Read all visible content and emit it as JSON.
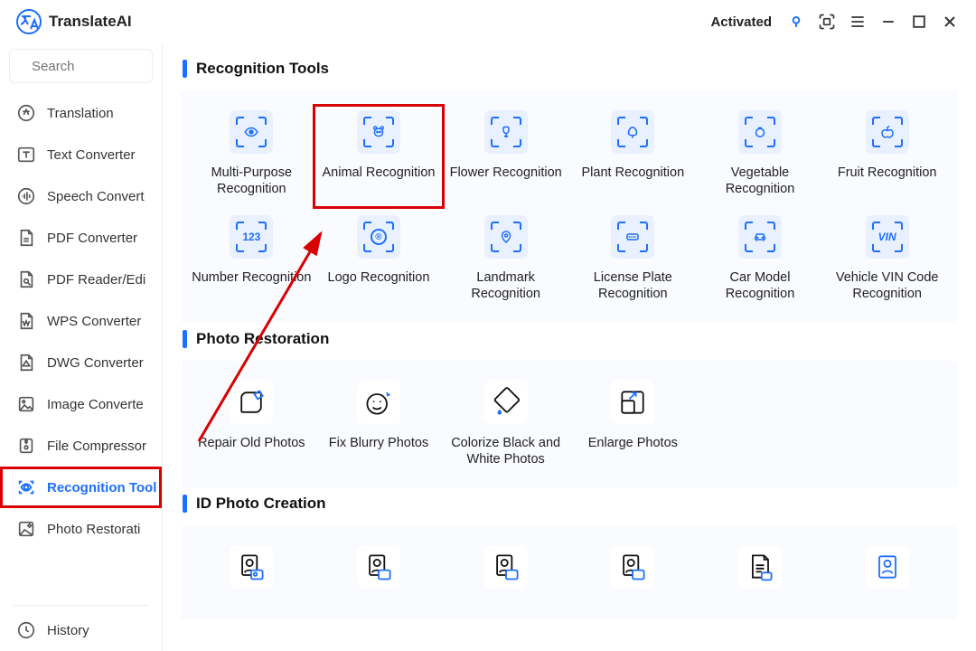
{
  "app": {
    "name": "TranslateAI",
    "status": "Activated"
  },
  "search": {
    "placeholder": "Search"
  },
  "sidebar": {
    "items": [
      {
        "label": "Translation"
      },
      {
        "label": "Text Converter"
      },
      {
        "label": "Speech Convert"
      },
      {
        "label": "PDF Converter"
      },
      {
        "label": "PDF Reader/Edi"
      },
      {
        "label": "WPS Converter"
      },
      {
        "label": "DWG Converter"
      },
      {
        "label": "Image Converte"
      },
      {
        "label": "File Compressor"
      },
      {
        "label": "Recognition Tool"
      },
      {
        "label": "Photo Restorati"
      }
    ],
    "history": "History"
  },
  "sections": {
    "recognition": {
      "title": "Recognition Tools",
      "tools": [
        {
          "label": "Multi-Purpose Recognition"
        },
        {
          "label": "Animal Recognition"
        },
        {
          "label": "Flower Recognition"
        },
        {
          "label": "Plant Recognition"
        },
        {
          "label": "Vegetable Recognition"
        },
        {
          "label": "Fruit Recognition"
        },
        {
          "label": "Number Recognition",
          "badge": "123"
        },
        {
          "label": "Logo Recognition",
          "badge": "®"
        },
        {
          "label": "Landmark Recognition"
        },
        {
          "label": "License Plate Recognition"
        },
        {
          "label": "Car Model Recognition"
        },
        {
          "label": "Vehicle VIN Code Recognition",
          "badge": "VIN"
        }
      ]
    },
    "restoration": {
      "title": "Photo Restoration",
      "tools": [
        {
          "label": "Repair Old Photos"
        },
        {
          "label": "Fix Blurry Photos"
        },
        {
          "label": "Colorize Black and White Photos"
        },
        {
          "label": "Enlarge Photos"
        }
      ]
    },
    "idphoto": {
      "title": "ID Photo Creation"
    }
  }
}
